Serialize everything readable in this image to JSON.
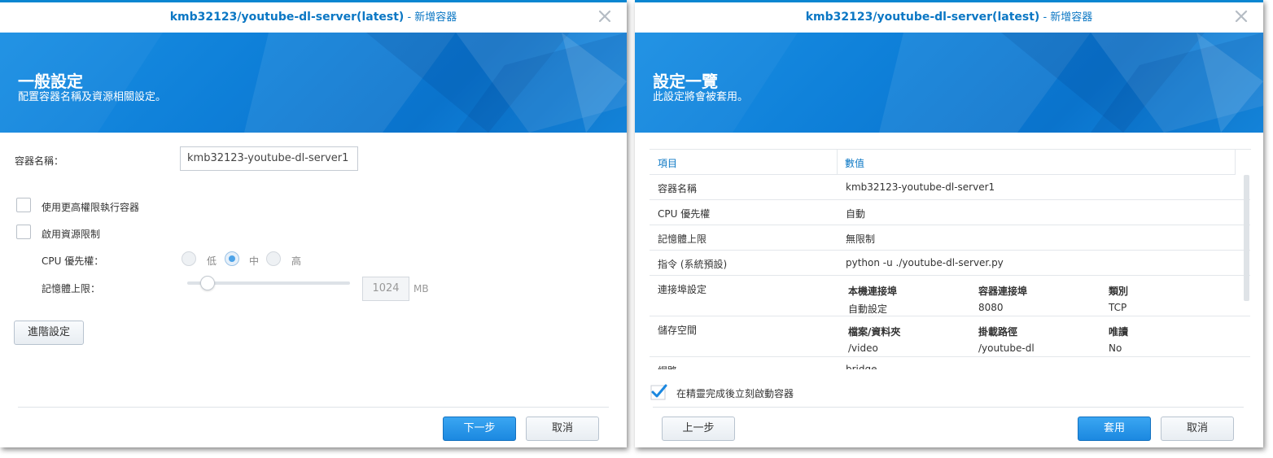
{
  "dialog1": {
    "title_main": "kmb32123/youtube-dl-server(latest)",
    "title_sub": " - 新增容器",
    "banner_title": "一般設定",
    "banner_subtitle": "配置容器名稱及資源相關設定。",
    "container_name_label": "容器名稱：",
    "container_name_value": "kmb32123-youtube-dl-server1",
    "privileged_label": "使用更高權限執行容器",
    "privileged_checked": false,
    "resource_limit_label": "啟用資源限制",
    "resource_limit_checked": false,
    "cpu_priority_label": "CPU 優先權：",
    "cpu_options": [
      "低",
      "中",
      "高"
    ],
    "cpu_selected": "中",
    "memory_label": "記憶體上限：",
    "memory_value": "1024",
    "memory_unit": "MB",
    "advanced_button": "進階設定",
    "next_button": "下一步",
    "cancel_button": "取消"
  },
  "dialog2": {
    "title_main": "kmb32123/youtube-dl-server(latest)",
    "title_sub": " - 新增容器",
    "banner_title": "設定一覽",
    "banner_subtitle": "此設定將會被套用。",
    "table_headers": [
      "項目",
      "數值"
    ],
    "rows": {
      "container_name": {
        "key": "容器名稱",
        "value": "kmb32123-youtube-dl-server1"
      },
      "cpu_priority": {
        "key": "CPU 優先權",
        "value": "自動"
      },
      "memory_limit": {
        "key": "記憶體上限",
        "value": "無限制"
      },
      "command": {
        "key": "指令 (系統預設)",
        "value": "python -u ./youtube-dl-server.py"
      },
      "port_settings": {
        "key": "連接埠設定",
        "headers": [
          "本機連接埠",
          "容器連接埠",
          "類別"
        ],
        "values": [
          "自動設定",
          "8080",
          "TCP"
        ]
      },
      "storage": {
        "key": "儲存空間",
        "headers": [
          "檔案/資料夾",
          "掛載路徑",
          "唯讀"
        ],
        "values": [
          "/video",
          "/youtube-dl",
          "No"
        ]
      },
      "network": {
        "key": "網路",
        "value": "bridge"
      }
    },
    "autostart_label": "在精靈完成後立刻啟動容器",
    "autostart_checked": true,
    "back_button": "上一步",
    "apply_button": "套用",
    "cancel_button": "取消"
  },
  "colors": {
    "accent": "#0b77c4",
    "banner": "#0e7fd8",
    "primary_button": "#1b88e0"
  }
}
